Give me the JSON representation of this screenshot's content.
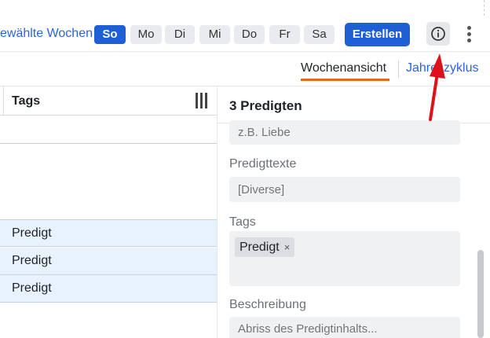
{
  "toolbar": {
    "selected_weeks_label": "ewählte Wochen",
    "days": [
      "So",
      "Mo",
      "Di",
      "Mi",
      "Do",
      "Fr",
      "Sa"
    ],
    "active_day": "So",
    "create_label": "Erstellen",
    "info_icon": "info-circle-icon",
    "more_icon": "vertical-dots-icon"
  },
  "views": {
    "week_label": "Wochenansicht",
    "year_label": "Jahreszyklus",
    "active": "Wochenansicht"
  },
  "table": {
    "column_header": "Tags",
    "columns_icon": "columns-icon",
    "rows": [
      "Predigt",
      "Predigt",
      "Predigt"
    ]
  },
  "panel": {
    "title": "3 Predigten",
    "theme_placeholder": "z.B. Liebe",
    "texts_label": "Predigttexte",
    "texts_value": "[Diverse]",
    "tags_label": "Tags",
    "tags": [
      {
        "label": "Predigt",
        "remove": "×"
      }
    ],
    "description_label": "Beschreibung",
    "description_placeholder": "Abriss des Predigtinhalts..."
  },
  "colors": {
    "accent": "#1f5fd6",
    "link": "#2c64d8",
    "tab_underline": "#e06c1c",
    "row_highlight": "#e8f2fc",
    "annotation": "#e0101a"
  }
}
